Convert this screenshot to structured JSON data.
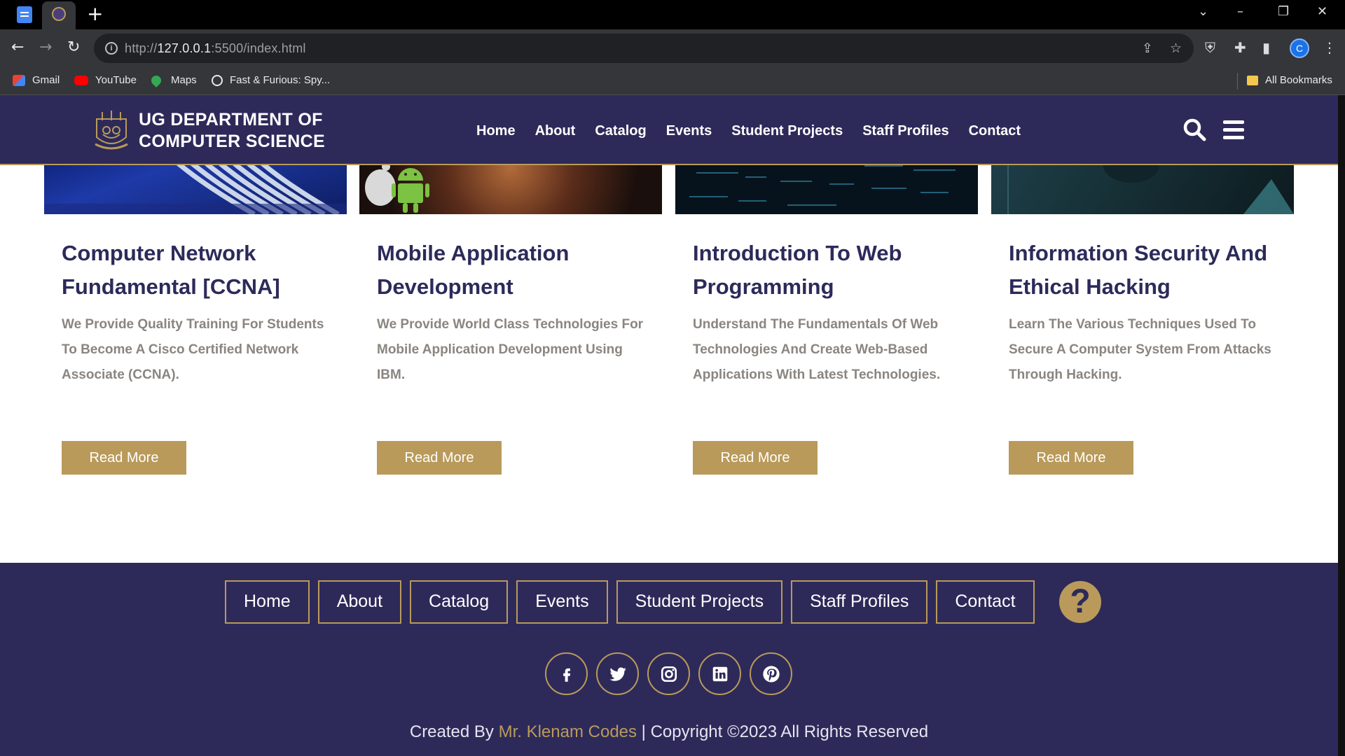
{
  "browser": {
    "url_scheme": "http://",
    "url_host": "127.0.0.1",
    "url_path": ":5500/index.html",
    "bookmarks": [
      {
        "label": "Gmail",
        "icon": "gmail-icon"
      },
      {
        "label": "YouTube",
        "icon": "youtube-icon"
      },
      {
        "label": "Maps",
        "icon": "maps-icon"
      },
      {
        "label": "Fast & Furious: Spy...",
        "icon": "globe-icon"
      }
    ],
    "all_bookmarks": "All Bookmarks",
    "profile_initial": "C"
  },
  "header": {
    "logo_line1": "UG DEPARTMENT OF",
    "logo_line2": "COMPUTER SCIENCE",
    "nav": [
      "Home",
      "About",
      "Catalog",
      "Events",
      "Student Projects",
      "Staff Profiles",
      "Contact"
    ]
  },
  "courses": [
    {
      "title": "Computer Network Fundamental [CCNA]",
      "description": "We Provide Quality Training For Students To Become A Cisco Certified Network Associate (CCNA).",
      "button": "Read More"
    },
    {
      "title": "Mobile Application Development",
      "description": "We Provide World Class Technologies For Mobile Application Development Using IBM.",
      "button": "Read More"
    },
    {
      "title": "Introduction To Web Programming",
      "description": "Understand The Fundamentals Of Web Technologies And Create Web-Based Applications With Latest Technologies.",
      "button": "Read More"
    },
    {
      "title": "Information Security And Ethical Hacking",
      "description": "Learn The Various Techniques Used To Secure A Computer System From Attacks Through Hacking.",
      "button": "Read More"
    }
  ],
  "footer": {
    "nav": [
      "Home",
      "About",
      "Catalog",
      "Events",
      "Student Projects",
      "Staff Profiles",
      "Contact"
    ],
    "help_symbol": "?",
    "socials": [
      "facebook-icon",
      "twitter-icon",
      "instagram-icon",
      "linkedin-icon",
      "pinterest-icon"
    ],
    "credit_prefix": "Created By ",
    "credit_author": "Mr. Klenam Codes",
    "credit_suffix": " | Copyright ©2023 All Rights Reserved"
  },
  "colors": {
    "brand_navy": "#2d2a5a",
    "brand_gold": "#b99a5a",
    "body_text": "#8a8580"
  }
}
